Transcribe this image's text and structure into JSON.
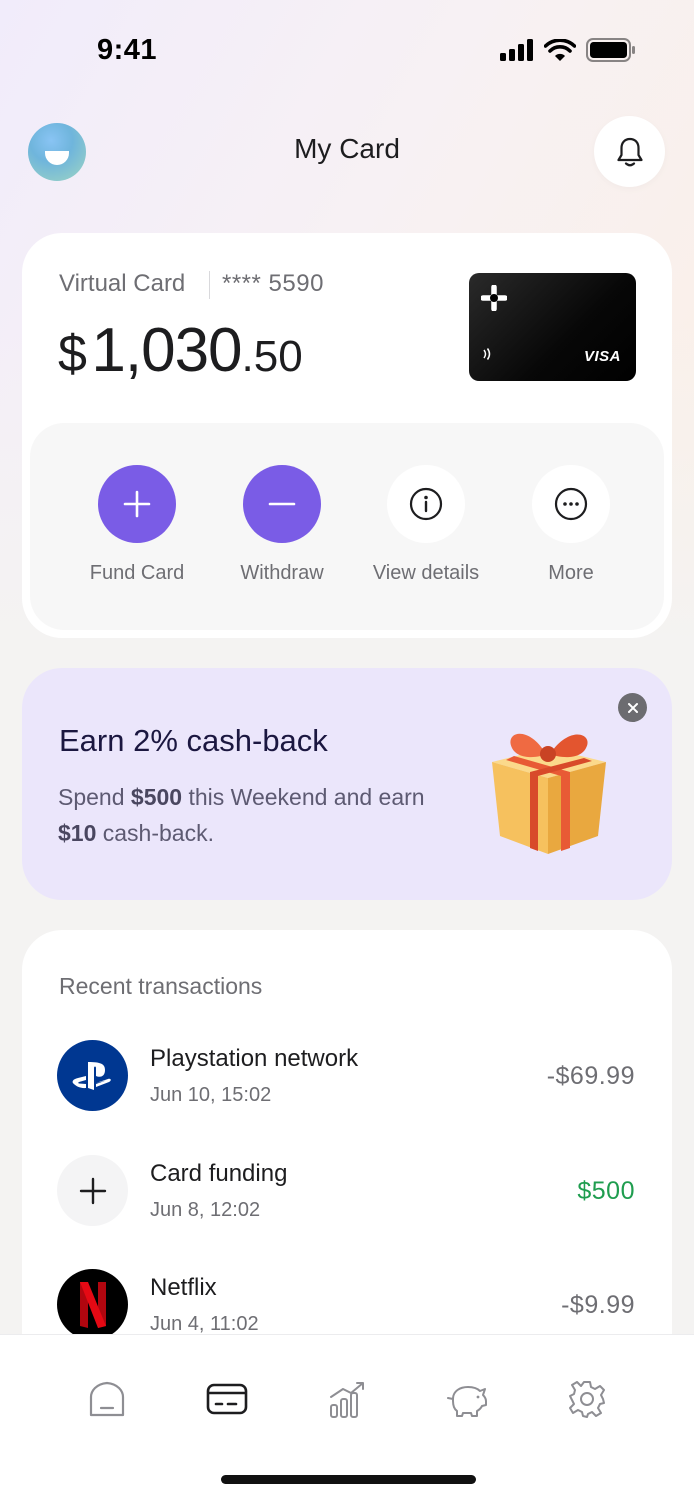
{
  "status_bar": {
    "time": "9:41"
  },
  "header": {
    "title": "My Card"
  },
  "card": {
    "label": "Virtual Card",
    "masked_number": "**** 5590",
    "balance_currency": "$",
    "balance_integer": "1,030",
    "balance_decimal": ".50",
    "brand": "VISA"
  },
  "actions": [
    {
      "label": "Fund Card",
      "icon": "plus-icon"
    },
    {
      "label": "Withdraw",
      "icon": "minus-icon"
    },
    {
      "label": "View details",
      "icon": "info-icon"
    },
    {
      "label": "More",
      "icon": "more-icon"
    }
  ],
  "promo": {
    "title": "Earn 2% cash-back",
    "text_1": "Spend ",
    "amount_1": "$500",
    "text_2": " this Weekend and earn ",
    "amount_2": "$10",
    "text_3": " cash-back."
  },
  "transactions": {
    "heading": "Recent transactions",
    "items": [
      {
        "name": "Playstation network",
        "date": "Jun 10, 15:02",
        "amount": "-$69.99",
        "icon": "playstation-logo-icon"
      },
      {
        "name": "Card funding",
        "date": "Jun 8, 12:02",
        "amount": "$500",
        "icon": "plus-icon"
      },
      {
        "name": "Netflix",
        "date": "Jun 4, 11:02",
        "amount": "-$9.99",
        "icon": "netflix-logo-icon"
      }
    ]
  },
  "nav": [
    "home-icon",
    "card-icon",
    "stats-icon",
    "savings-icon",
    "settings-icon"
  ],
  "colors": {
    "accent": "#7a5ce6",
    "positive": "#1f9d4f",
    "promo_bg": "#ebe6fb"
  }
}
